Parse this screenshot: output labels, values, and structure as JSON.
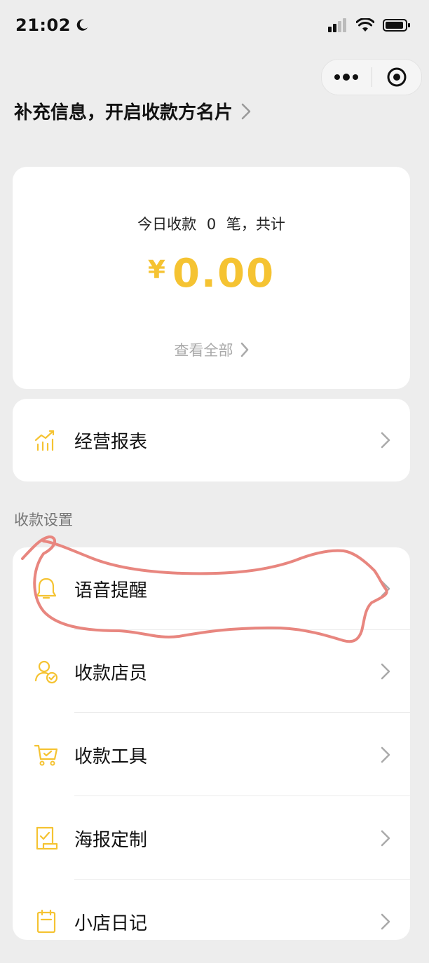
{
  "status": {
    "time": "21:02"
  },
  "capsule": {
    "more_icon": "more-dots-icon",
    "close_icon": "target-icon"
  },
  "header": {
    "title": "补充信息，开启收款方名片"
  },
  "summary": {
    "line_prefix": "今日收款",
    "count": "0",
    "line_suffix": "笔，共计",
    "currency": "¥",
    "amount": "0.00",
    "view_all": "查看全部"
  },
  "report": {
    "label": "经营报表",
    "icon": "bar-chart-icon"
  },
  "settings": {
    "section_label": "收款设置",
    "items": [
      {
        "label": "语音提醒",
        "icon": "bell-icon"
      },
      {
        "label": "收款店员",
        "icon": "staff-icon"
      },
      {
        "label": "收款工具",
        "icon": "cart-icon"
      },
      {
        "label": "海报定制",
        "icon": "poster-icon"
      },
      {
        "label": "小店日记",
        "icon": "notebook-icon"
      }
    ]
  },
  "colors": {
    "accent": "#f5c332",
    "annotation": "#e8867f",
    "background": "#ededed"
  }
}
